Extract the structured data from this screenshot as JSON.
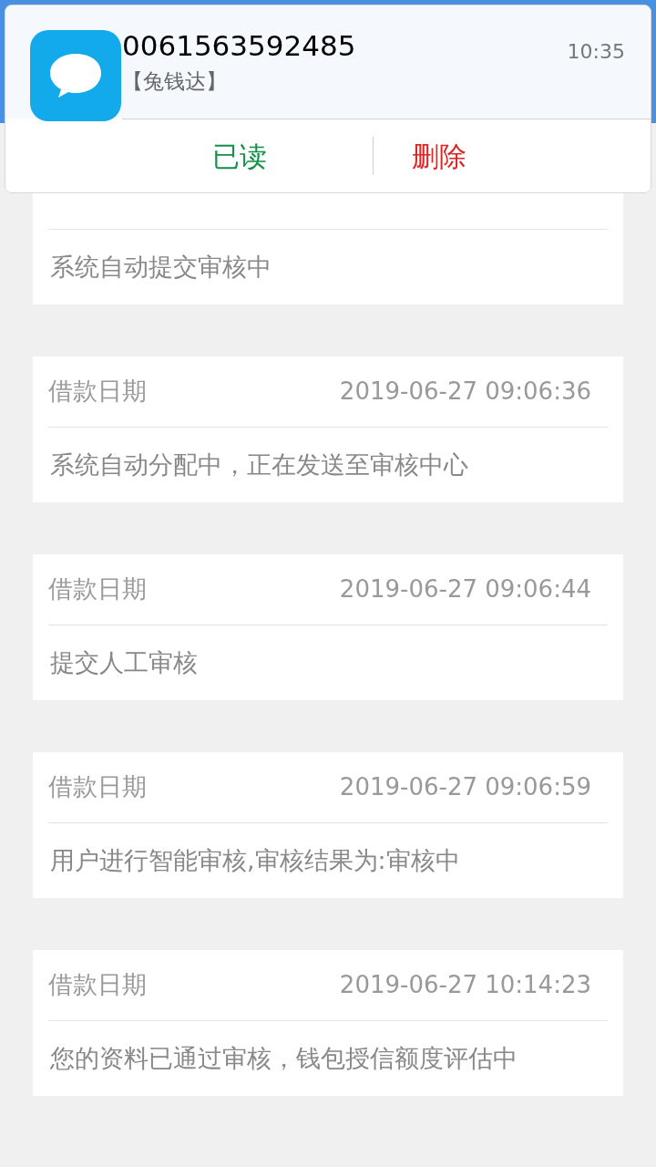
{
  "notification": {
    "sender": "0061563592485",
    "time": "10:35",
    "preview": "【兔钱达】",
    "actions": [
      {
        "label": "已读",
        "kind": "confirm"
      },
      {
        "label": "删除",
        "kind": "danger"
      }
    ]
  },
  "records": [
    {
      "message": "系统自动提交审核中"
    },
    {
      "label": "借款日期",
      "date": "2019-06-27 09:06:36",
      "message": "系统自动分配中，正在发送至审核中心"
    },
    {
      "label": "借款日期",
      "date": "2019-06-27 09:06:44",
      "message": "提交人工审核"
    },
    {
      "label": "借款日期",
      "date": "2019-06-27 09:06:59",
      "message": "用户进行智能审核,审核结果为:审核中"
    },
    {
      "label": "借款日期",
      "date": "2019-06-27 10:14:23",
      "message": "您的资料已通过审核，钱包授信额度评估中"
    }
  ]
}
